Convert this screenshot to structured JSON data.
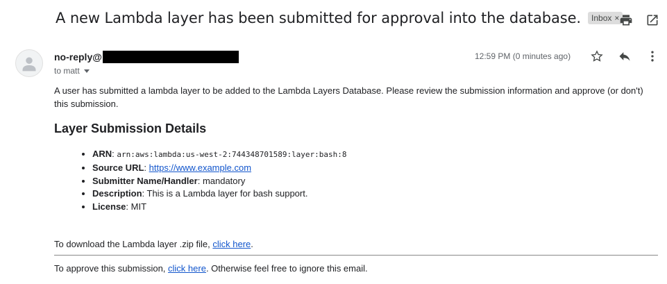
{
  "subject": "A new Lambda layer has been submitted for approval into the database.",
  "label": {
    "name": "Inbox",
    "remove": "×"
  },
  "top_actions": [
    {
      "name": "print-icon"
    },
    {
      "name": "open-in-new-window-icon"
    }
  ],
  "sender": {
    "name": "no-reply@",
    "recipient": "to matt"
  },
  "timestamp": "12:59 PM (0 minutes ago)",
  "msg_actions": [
    {
      "name": "star-icon"
    },
    {
      "name": "reply-icon"
    },
    {
      "name": "more-vert-icon"
    }
  ],
  "body": {
    "intro": "A user has submitted a lambda layer to be added to the Lambda Layers Database. Please review the submission information and approve (or don't) this submission.",
    "heading": "Layer Submission Details",
    "details": [
      {
        "label": "ARN",
        "value": "arn:aws:lambda:us-west-2:744348701589:layer:bash:8"
      },
      {
        "label": "Source URL",
        "value": "https://www.example.com"
      },
      {
        "label": "Submitter Name/Handler",
        "value": "mandatory"
      },
      {
        "label": "Description",
        "value": "This is a Lambda layer for bash support."
      },
      {
        "label": "License",
        "value": "MIT"
      }
    ],
    "download_prefix": "To download the Lambda layer .zip file, ",
    "download_link": "click here",
    "download_suffix": ".",
    "approve_prefix": "To approve this submission, ",
    "approve_link": "click here",
    "approve_suffix": ". Otherwise feel free to ignore this email."
  }
}
